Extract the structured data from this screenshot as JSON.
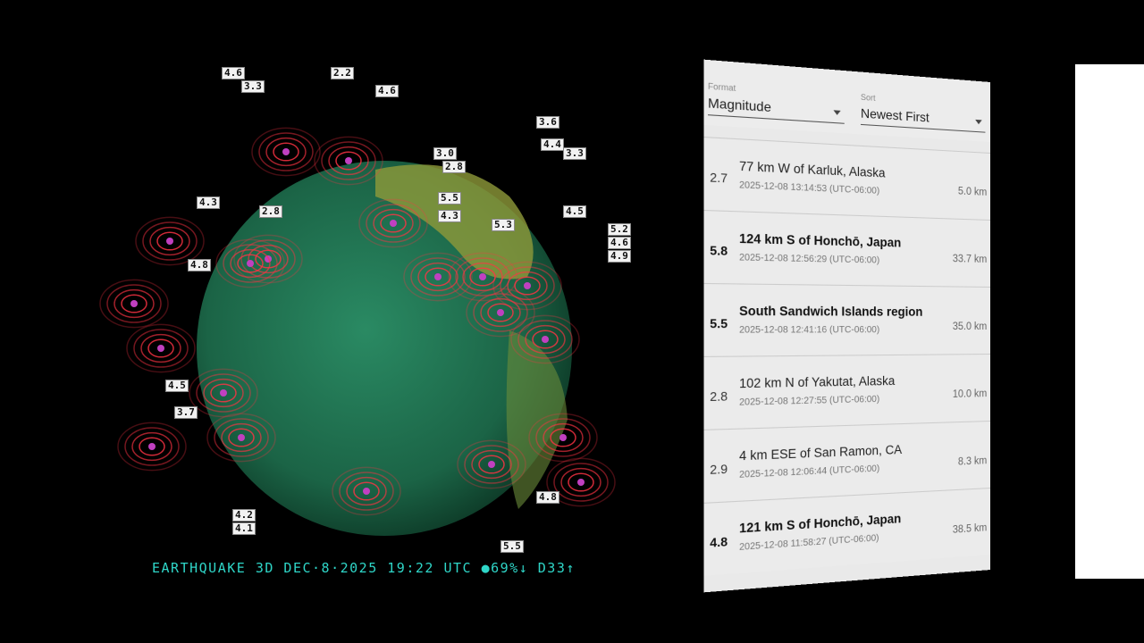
{
  "status_bar": "EARTHQUAKE 3D DEC·8·2025 19:22 UTC ●69%↓ D33↑",
  "colors": {
    "ocean": "#1f6e4e",
    "ring": "#ff3344",
    "status": "#2fd6c8",
    "panel": "#e9e9e9"
  },
  "filters": {
    "format": {
      "label": "Format",
      "value": "Magnitude"
    },
    "sort": {
      "label": "Sort",
      "value": "Newest First"
    }
  },
  "quakes": [
    {
      "mag": "2.7",
      "place": "77 km W of Karluk, Alaska",
      "time": "2025-12-08 13:14:53 (UTC-06:00)",
      "depth": "5.0 km",
      "strong": false
    },
    {
      "mag": "5.8",
      "place": "124 km S of Honchō, Japan",
      "time": "2025-12-08 12:56:29 (UTC-06:00)",
      "depth": "33.7 km",
      "strong": true
    },
    {
      "mag": "5.5",
      "place": "South Sandwich Islands region",
      "time": "2025-12-08 12:41:16 (UTC-06:00)",
      "depth": "35.0 km",
      "strong": true
    },
    {
      "mag": "2.8",
      "place": "102 km N of Yakutat, Alaska",
      "time": "2025-12-08 12:27:55 (UTC-06:00)",
      "depth": "10.0 km",
      "strong": false
    },
    {
      "mag": "2.9",
      "place": "4 km ESE of San Ramon, CA",
      "time": "2025-12-08 12:06:44 (UTC-06:00)",
      "depth": "8.3 km",
      "strong": false
    },
    {
      "mag": "4.8",
      "place": "121 km S of Honchō, Japan",
      "time": "2025-12-08 11:58:27 (UTC-06:00)",
      "depth": "38.5 km",
      "strong": true
    }
  ],
  "globe_labels": [
    "4.6",
    "2.2",
    "3.3",
    "4.6",
    "3.6",
    "4.4",
    "3.0",
    "2.8",
    "5.5",
    "4.3",
    "2.8",
    "5.3",
    "3.3",
    "4.5",
    "5.2",
    "4.6",
    "4.9",
    "4.3",
    "4.8",
    "4.5",
    "4.2",
    "4.1",
    "5.5",
    "4.8",
    "3.7"
  ]
}
